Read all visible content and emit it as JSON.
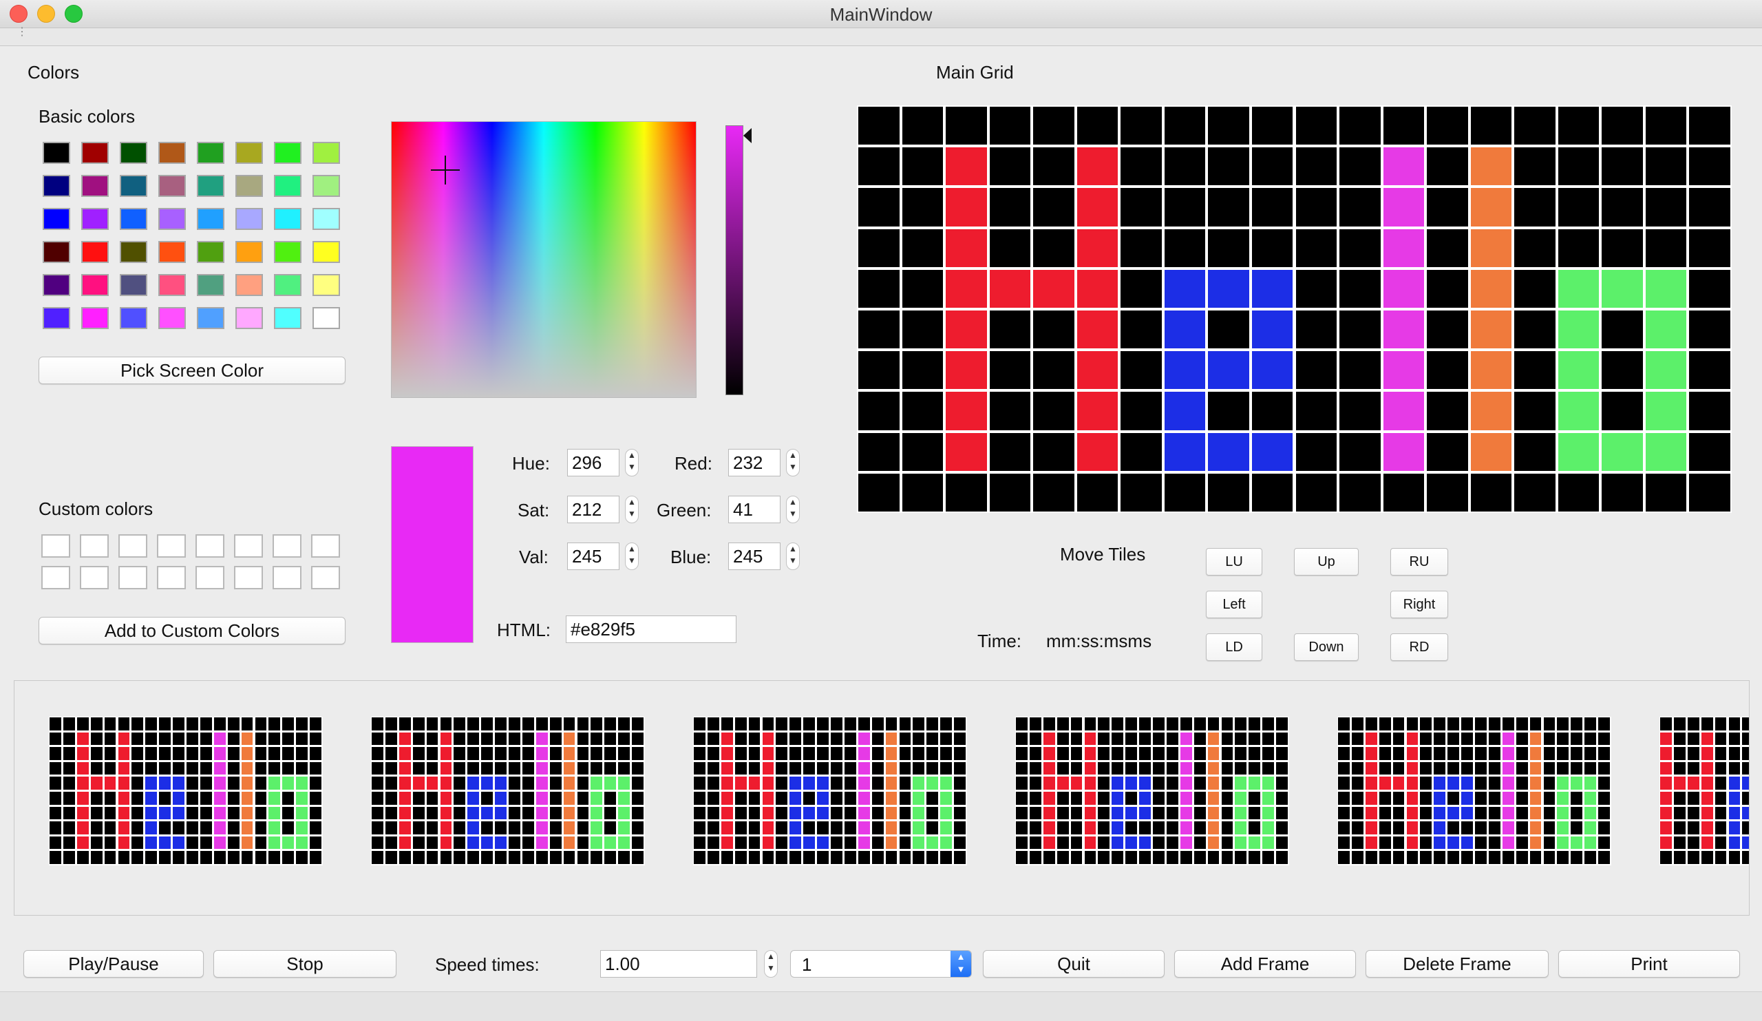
{
  "window": {
    "title": "MainWindow"
  },
  "colors_panel": {
    "group_label": "Colors",
    "basic_colors_label": "Basic colors",
    "custom_colors_label": "Custom colors",
    "pick_screen_color_label": "Pick Screen Color",
    "add_custom_label": "Add to Custom Colors",
    "basic_colors": [
      "#000000",
      "#a00000",
      "#005000",
      "#b05818",
      "#20a020",
      "#a8a820",
      "#20f020",
      "#a0f040",
      "#000080",
      "#a01080",
      "#106080",
      "#a86080",
      "#20a080",
      "#a8a880",
      "#20f080",
      "#a0f080",
      "#0000ff",
      "#a020ff",
      "#1060ff",
      "#a860ff",
      "#20a0ff",
      "#a8a8ff",
      "#20f0ff",
      "#a0ffff",
      "#500000",
      "#ff1010",
      "#505000",
      "#ff5010",
      "#50a010",
      "#ffa010",
      "#50f010",
      "#ffff20",
      "#500080",
      "#ff1080",
      "#505080",
      "#ff5080",
      "#50a080",
      "#ffa080",
      "#50f080",
      "#ffff80",
      "#5020ff",
      "#ff20ff",
      "#5050ff",
      "#ff50ff",
      "#50a0ff",
      "#ffa8ff",
      "#50ffff",
      "#ffffff"
    ],
    "hue_label": "Hue:",
    "hue": "296",
    "sat_label": "Sat:",
    "sat": "212",
    "val_label": "Val:",
    "val": "245",
    "red_label": "Red:",
    "red": "232",
    "green_label": "Green:",
    "green": "41",
    "blue_label": "Blue:",
    "blue": "245",
    "html_label": "HTML:",
    "html": "#e829f5",
    "current_color": "#e829f5"
  },
  "main_grid": {
    "label": "Main Grid",
    "rows": 10,
    "cols": 20,
    "cells": [
      "....................",
      "..R..R......M.O.....",
      "..R..R......M.O.....",
      "..R..R......M.O.....",
      "..RRRR.BBB..M.O.GGG.",
      "..R..R.B.B..M.O.G.G.",
      "..R..R.BBB..M.O.G.G.",
      "..R..R.B....M.O.G.G.",
      "..R..R.BBB..M.O.GGG.",
      "...................."
    ],
    "palette": {
      ".": "#000000",
      "R": "#ee1c2e",
      "B": "#1c2ee6",
      "M": "#e63ae6",
      "O": "#f07a3c",
      "G": "#5cf06a"
    }
  },
  "move_tiles": {
    "label": "Move Tiles",
    "lu": "LU",
    "up": "Up",
    "ru": "RU",
    "left": "Left",
    "right": "Right",
    "ld": "LD",
    "down": "Down",
    "rd": "RD",
    "time_label": "Time:",
    "time_value": "mm:ss:msms"
  },
  "frames": [
    [
      "....................",
      "..R..R......M.O.....",
      "..R..R......M.O.....",
      "..R..R......M.O.....",
      "..RRRR.BBB..M.O.GGG.",
      "..R..R.B.B..M.O.G.G.",
      "..R..R.BBB..M.O.G.G.",
      "..R..R.B....M.O.G.G.",
      "..R..R.BBB..M.O.GGG.",
      "...................."
    ],
    [
      "....................",
      "..R..R......M.O.....",
      "..R..R......M.O.....",
      "..R..R......M.O.....",
      "..RRRR.BBB..M.O.GGG.",
      "..R..R.B.B..M.O.G.G.",
      "..R..R.BBB..M.O.G.G.",
      "..R..R.B....M.O.G.G.",
      "..R..R.BBB..M.O.GGG.",
      "...................."
    ],
    [
      "....................",
      "..R..R......M.O.....",
      "..R..R......M.O.....",
      "..R..R......M.O.....",
      "..RRRR.BBB..M.O.GGG.",
      "..R..R.B.B..M.O.G.G.",
      "..R..R.BBB..M.O.G.G.",
      "..R..R.B....M.O.G.G.",
      "..R..R.BBB..M.O.GGG.",
      "...................."
    ],
    [
      "....................",
      "..R..R......M.O.....",
      "..R..R......M.O.....",
      "..R..R......M.O.....",
      "..RRRR.BBB..M.O.GGG.",
      "..R..R.B.B..M.O.G.G.",
      "..R..R.BBB..M.O.G.G.",
      "..R..R.B....M.O.G.G.",
      "..R..R.BBB..M.O.GGG.",
      "...................."
    ],
    [
      "....................",
      "..R..R......M.O.....",
      "..R..R......M.O.....",
      "..R..R......M.O.....",
      "..RRRR.BBB..M.O.GGG.",
      "..R..R.B.B..M.O.G.G.",
      "..R..R.BBB..M.O.G.G.",
      "..R..R.B....M.O.G.G.",
      "..R..R.BBB..M.O.GGG.",
      "...................."
    ],
    [
      "....................",
      "R..R......M.O.......",
      "R..R......M.O.......",
      "R..R......M.O.......",
      "RRRR.BBB..M.O.GGG...",
      "R..R.B.B..M.O.G.G...",
      "R..R.BBB..M.O.G.G...",
      "R..R.B....M.O.G.G...",
      "R..R.BBB..M.O.GGG...",
      "...................."
    ]
  ],
  "controls": {
    "play_pause": "Play/Pause",
    "stop": "Stop",
    "speed_label": "Speed times:",
    "speed_value": "1.00",
    "frame_select_value": "1",
    "quit": "Quit",
    "add_frame": "Add Frame",
    "delete_frame": "Delete Frame",
    "print": "Print"
  }
}
